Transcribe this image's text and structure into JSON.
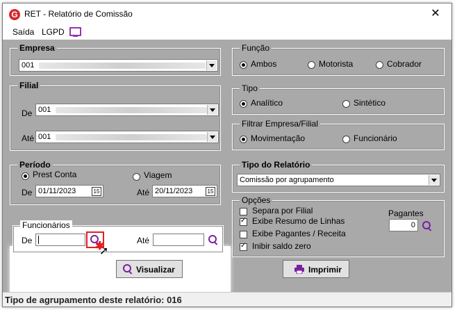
{
  "window": {
    "title": "RET - Relatório de Comissão",
    "app_icon_letter": "G"
  },
  "menu": {
    "items": [
      "Saída",
      "LGPD"
    ],
    "monitor_icon": "monitor-icon"
  },
  "empresa": {
    "title": "Empresa",
    "value": "001"
  },
  "filial": {
    "title": "Filial",
    "de_label": "De",
    "de_value": "001",
    "ate_label": "Até",
    "ate_value": "001"
  },
  "periodo": {
    "title": "Período",
    "option_prest": "Prest Conta",
    "option_viagem": "Viagem",
    "selected": "Prest Conta",
    "de_label": "De",
    "de_value": "01/11/2023",
    "ate_label": "Até",
    "ate_value": "20/11/2023",
    "calendar_glyph": "15"
  },
  "funcionarios": {
    "title": "Funcionários",
    "de_label": "De",
    "ate_label": "Até",
    "de_value": "",
    "ate_value": ""
  },
  "funcao": {
    "title": "Função",
    "options": [
      "Ambos",
      "Motorista",
      "Cobrador"
    ],
    "selected": "Ambos"
  },
  "tipo": {
    "title": "Tipo",
    "options": [
      "Analítico",
      "Sintético"
    ],
    "selected": "Analítico"
  },
  "filtrar": {
    "title": "Filtrar Empresa/Filial",
    "options": [
      "Movimentação",
      "Funcionário"
    ],
    "selected": "Movimentação"
  },
  "tipo_relatorio": {
    "title": "Tipo do Relatório",
    "value": "Comissão por agrupamento"
  },
  "opcoes": {
    "title": "Opções",
    "checks": [
      {
        "label": "Separa por Filial",
        "checked": false
      },
      {
        "label": "Exibe Resumo de Linhas",
        "checked": true
      },
      {
        "label": "Exibe Pagantes / Receita",
        "checked": false
      },
      {
        "label": "Inibir saldo zero",
        "checked": true
      }
    ],
    "pagantes_label": "Pagantes",
    "pagantes_value": "0"
  },
  "buttons": {
    "visualizar": "Visualizar",
    "imprimir": "Imprimir"
  },
  "status": {
    "text": "Tipo de agrupamento deste relatório: 016"
  },
  "colors": {
    "accent": "#7b1fa2",
    "highlight_box": "#e02020",
    "form_bg": "#a9a9a9"
  }
}
